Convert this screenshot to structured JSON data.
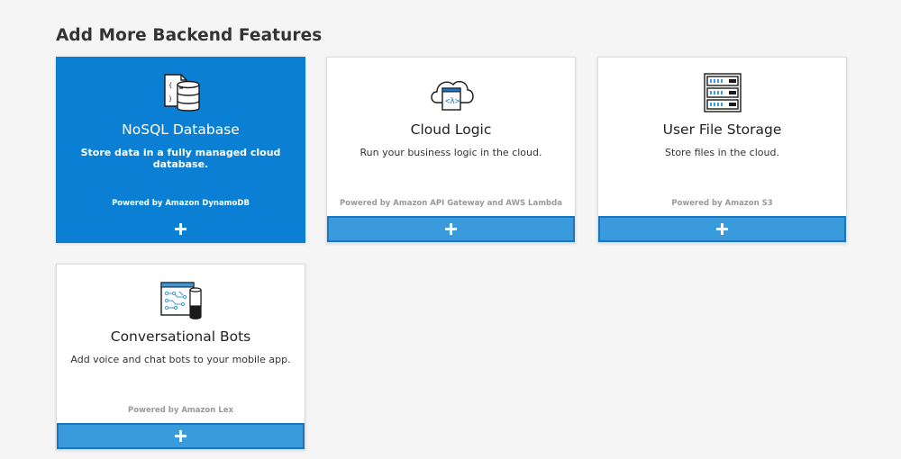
{
  "section": {
    "title": "Add More Backend Features"
  },
  "cards": [
    {
      "title": "NoSQL Database",
      "description": "Store data in a fully managed cloud database.",
      "powered_by": "Powered by Amazon DynamoDB",
      "icon": "database-icon",
      "selected": true
    },
    {
      "title": "Cloud Logic",
      "description": "Run your business logic in the cloud.",
      "powered_by": "Powered by Amazon API Gateway and AWS Lambda",
      "icon": "cloud-logic-icon",
      "selected": false
    },
    {
      "title": "User File Storage",
      "description": "Store files in the cloud.",
      "powered_by": "Powered by Amazon S3",
      "icon": "server-storage-icon",
      "selected": false
    },
    {
      "title": "Conversational Bots",
      "description": "Add voice and chat bots to your mobile app.",
      "powered_by": "Powered by Amazon Lex",
      "icon": "chatbot-icon",
      "selected": false
    }
  ],
  "add_icon": "plus-icon",
  "colors": {
    "selected_card": "#0b7fd3",
    "add_bar": "#3a9bdc",
    "add_bar_border": "#1a76c2",
    "background": "#f5f5f5"
  }
}
